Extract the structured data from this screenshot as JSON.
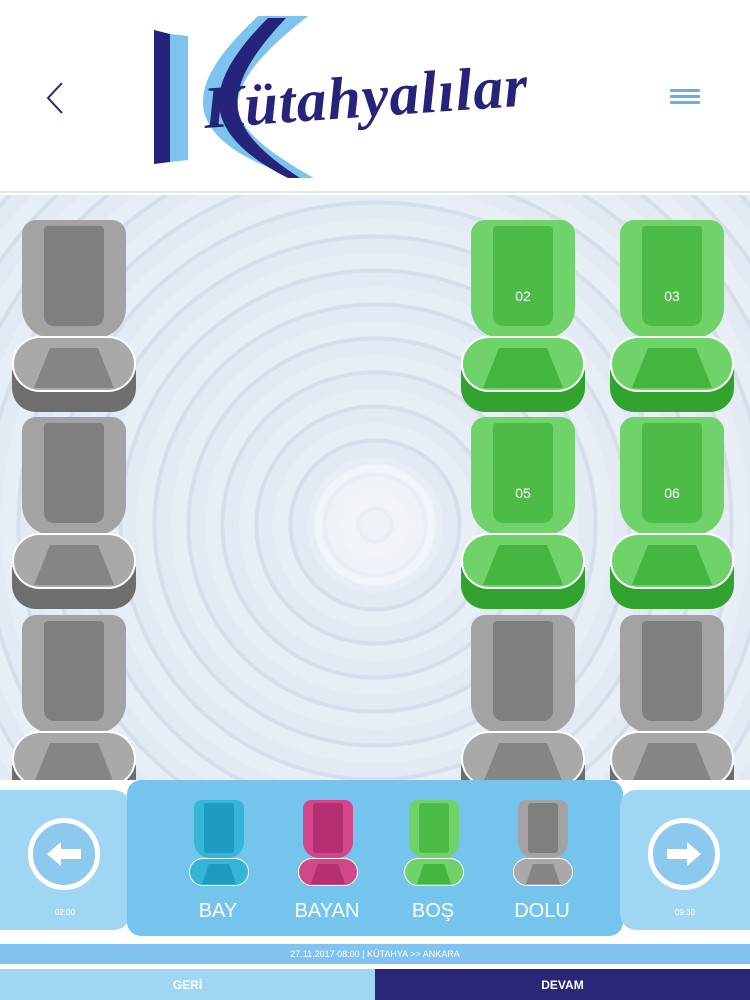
{
  "header": {
    "logo_text": "Kütahyalılar",
    "logo_letter": "K",
    "back_icon": "chevron-left-icon",
    "menu_icon": "hamburger-menu-icon"
  },
  "seats": [
    {
      "id": "left-1",
      "number": "",
      "status": "full"
    },
    {
      "id": "left-2",
      "number": "",
      "status": "full"
    },
    {
      "id": "left-3",
      "number": "",
      "status": "full"
    },
    {
      "id": "02",
      "number": "02",
      "status": "empty"
    },
    {
      "id": "03",
      "number": "03",
      "status": "empty"
    },
    {
      "id": "05",
      "number": "05",
      "status": "empty"
    },
    {
      "id": "06",
      "number": "06",
      "status": "empty"
    },
    {
      "id": "right-row3-a",
      "number": "",
      "status": "full"
    },
    {
      "id": "right-row3-b",
      "number": "",
      "status": "full"
    }
  ],
  "legend": {
    "bay": "BAY",
    "bayan": "BAYAN",
    "bos": "BOŞ",
    "dolu": "DOLU"
  },
  "colors": {
    "bay": "#2aa9cc",
    "bayan": "#c8377e",
    "bos": "#4cbc47",
    "dolu": "#7f7f7f",
    "brand": "#26237a",
    "accent": "#74c4ee"
  },
  "navigation": {
    "prev_time": "02:00",
    "next_time": "09:30",
    "prev_icon": "arrow-left-icon",
    "next_icon": "arrow-right-icon"
  },
  "trip_info": "27.11.2017 08:00 | KÜTAHYA >> ANKARA",
  "buttons": {
    "back": "GERİ",
    "continue": "DEVAM"
  }
}
